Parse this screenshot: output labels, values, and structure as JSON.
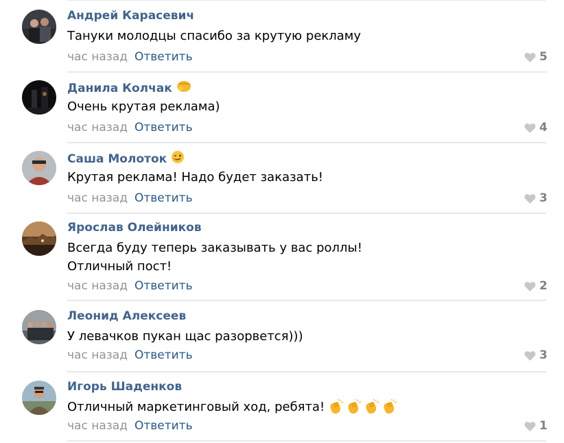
{
  "comments": [
    {
      "author": "Андрей Карасевич",
      "text_lines": [
        "Тануки молодцы спасибо за крутую рекламу"
      ],
      "time": "час назад",
      "reply_label": "Ответить",
      "likes": "5"
    },
    {
      "author": "Данила Колчак",
      "author_emoji": "fist-emoji",
      "text_lines": [
        "Очень крутая реклама)"
      ],
      "time": "час назад",
      "reply_label": "Ответить",
      "likes": "4"
    },
    {
      "author": "Саша Молоток",
      "author_emoji": "wink-emoji",
      "text_lines": [
        "Крутая реклама! Надо будет заказать!"
      ],
      "time": "час назад",
      "reply_label": "Ответить",
      "likes": "3"
    },
    {
      "author": "Ярослав Олейников",
      "text_lines": [
        "Всегда буду теперь заказывать у вас роллы!",
        "Отличный пост!"
      ],
      "time": "час назад",
      "reply_label": "Ответить",
      "likes": "2"
    },
    {
      "author": "Леонид Алексеев",
      "text_lines": [
        "У левачков пукан щас разорвется)))"
      ],
      "time": "час назад",
      "reply_label": "Ответить",
      "likes": "3"
    },
    {
      "author": "Игорь Шаденков",
      "text_lines": [
        "Отличный маркетинговый ход, ребята!"
      ],
      "text_emoji": [
        "clap-emoji",
        "clap-emoji",
        "clap-emoji",
        "clap-emoji"
      ],
      "time": "час назад",
      "reply_label": "Ответить",
      "likes": "1"
    }
  ],
  "colors": {
    "author": "#42648b",
    "reply": "#2a5885",
    "meta": "#939393",
    "likes": "#828282",
    "divider": "#e7e8ec"
  }
}
